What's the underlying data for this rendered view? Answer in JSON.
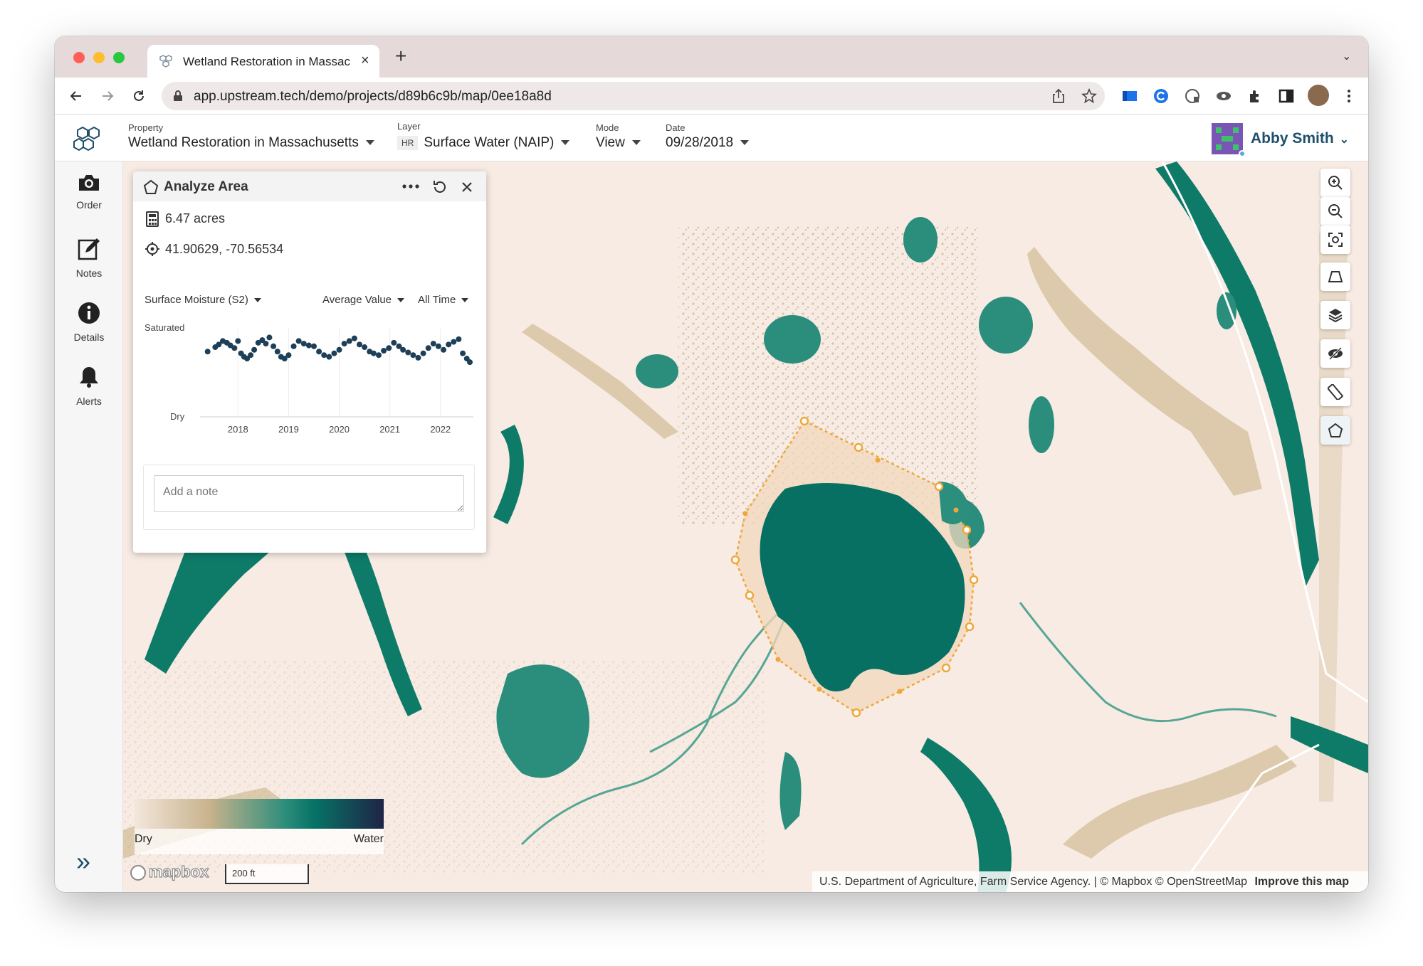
{
  "browser": {
    "tab_title": "Wetland Restoration in Massac",
    "url": "app.upstream.tech/demo/projects/d89b6c9b/map/0ee18a8d",
    "new_tab_symbol": "+"
  },
  "header": {
    "property_label": "Property",
    "property_value": "Wetland Restoration in Massachusetts",
    "layer_label": "Layer",
    "layer_badge": "HR",
    "layer_value": "Surface Water (NAIP)",
    "mode_label": "Mode",
    "mode_value": "View",
    "date_label": "Date",
    "date_value": "09/28/2018",
    "user_name": "Abby Smith"
  },
  "sidebar": {
    "items": [
      {
        "label": "Order",
        "icon": "camera-icon"
      },
      {
        "label": "Notes",
        "icon": "edit-icon"
      },
      {
        "label": "Details",
        "icon": "info-icon"
      },
      {
        "label": "Alerts",
        "icon": "bell-icon"
      }
    ],
    "expand_symbol": "»"
  },
  "panel": {
    "title": "Analyze Area",
    "area": "6.47 acres",
    "coords": "41.90629, -70.56534",
    "metric_select": "Surface Moisture (S2)",
    "agg_select": "Average Value",
    "time_select": "All Time",
    "note_placeholder": "Add a note"
  },
  "chart_data": {
    "type": "scatter",
    "ylabel_top": "Saturated",
    "ylabel_bottom": "Dry",
    "x_ticks": [
      "2018",
      "2019",
      "2020",
      "2021",
      "2022"
    ],
    "x_range": [
      2017.25,
      2022.65
    ],
    "y_range": [
      0,
      1
    ],
    "series": [
      {
        "values": [
          [
            2017.4,
            0.74
          ],
          [
            2017.55,
            0.79
          ],
          [
            2017.62,
            0.82
          ],
          [
            2017.7,
            0.86
          ],
          [
            2017.78,
            0.84
          ],
          [
            2017.85,
            0.81
          ],
          [
            2017.93,
            0.78
          ],
          [
            2018.0,
            0.86
          ],
          [
            2018.06,
            0.72
          ],
          [
            2018.12,
            0.68
          ],
          [
            2018.18,
            0.66
          ],
          [
            2018.25,
            0.7
          ],
          [
            2018.32,
            0.76
          ],
          [
            2018.4,
            0.84
          ],
          [
            2018.48,
            0.87
          ],
          [
            2018.55,
            0.83
          ],
          [
            2018.62,
            0.9
          ],
          [
            2018.7,
            0.8
          ],
          [
            2018.78,
            0.74
          ],
          [
            2018.85,
            0.68
          ],
          [
            2018.92,
            0.66
          ],
          [
            2019.0,
            0.7
          ],
          [
            2019.1,
            0.8
          ],
          [
            2019.2,
            0.86
          ],
          [
            2019.3,
            0.83
          ],
          [
            2019.4,
            0.81
          ],
          [
            2019.5,
            0.8
          ],
          [
            2019.6,
            0.74
          ],
          [
            2019.7,
            0.7
          ],
          [
            2019.8,
            0.68
          ],
          [
            2019.9,
            0.72
          ],
          [
            2020.0,
            0.76
          ],
          [
            2020.1,
            0.83
          ],
          [
            2020.2,
            0.86
          ],
          [
            2020.3,
            0.89
          ],
          [
            2020.4,
            0.82
          ],
          [
            2020.5,
            0.79
          ],
          [
            2020.6,
            0.74
          ],
          [
            2020.68,
            0.72
          ],
          [
            2020.78,
            0.7
          ],
          [
            2020.88,
            0.75
          ],
          [
            2020.98,
            0.78
          ],
          [
            2021.08,
            0.84
          ],
          [
            2021.18,
            0.8
          ],
          [
            2021.26,
            0.76
          ],
          [
            2021.36,
            0.73
          ],
          [
            2021.46,
            0.7
          ],
          [
            2021.56,
            0.67
          ],
          [
            2021.66,
            0.72
          ],
          [
            2021.76,
            0.78
          ],
          [
            2021.86,
            0.83
          ],
          [
            2021.96,
            0.8
          ],
          [
            2022.06,
            0.76
          ],
          [
            2022.16,
            0.82
          ],
          [
            2022.26,
            0.85
          ],
          [
            2022.36,
            0.88
          ],
          [
            2022.44,
            0.72
          ],
          [
            2022.52,
            0.66
          ],
          [
            2022.58,
            0.62
          ]
        ]
      }
    ]
  },
  "legend": {
    "left_label": "Dry",
    "right_label": "Water",
    "gradient_colors": [
      "#f3e6dc",
      "#c8b38c",
      "#2f8e7c",
      "#067366",
      "#1f2445"
    ]
  },
  "map": {
    "scale_label": "200 ft",
    "attribution": "U.S. Department of Agriculture, Farm Service Agency. | © Mapbox © OpenStreetMap",
    "improve_link": "Improve this map",
    "mapbox_logo": "mapbox",
    "colors": {
      "background": "#f7ebe3",
      "water_dark": "#086f62",
      "water_mid": "#2c8f7d",
      "dry_tan": "#d6c3a3",
      "polygon_stroke": "#f0a73a",
      "polygon_fill": "#f3d8bd"
    }
  },
  "colors": {
    "accent": "#2d9b8f",
    "brand": "#1e4f6b",
    "chart_point": "#1d3f58"
  }
}
